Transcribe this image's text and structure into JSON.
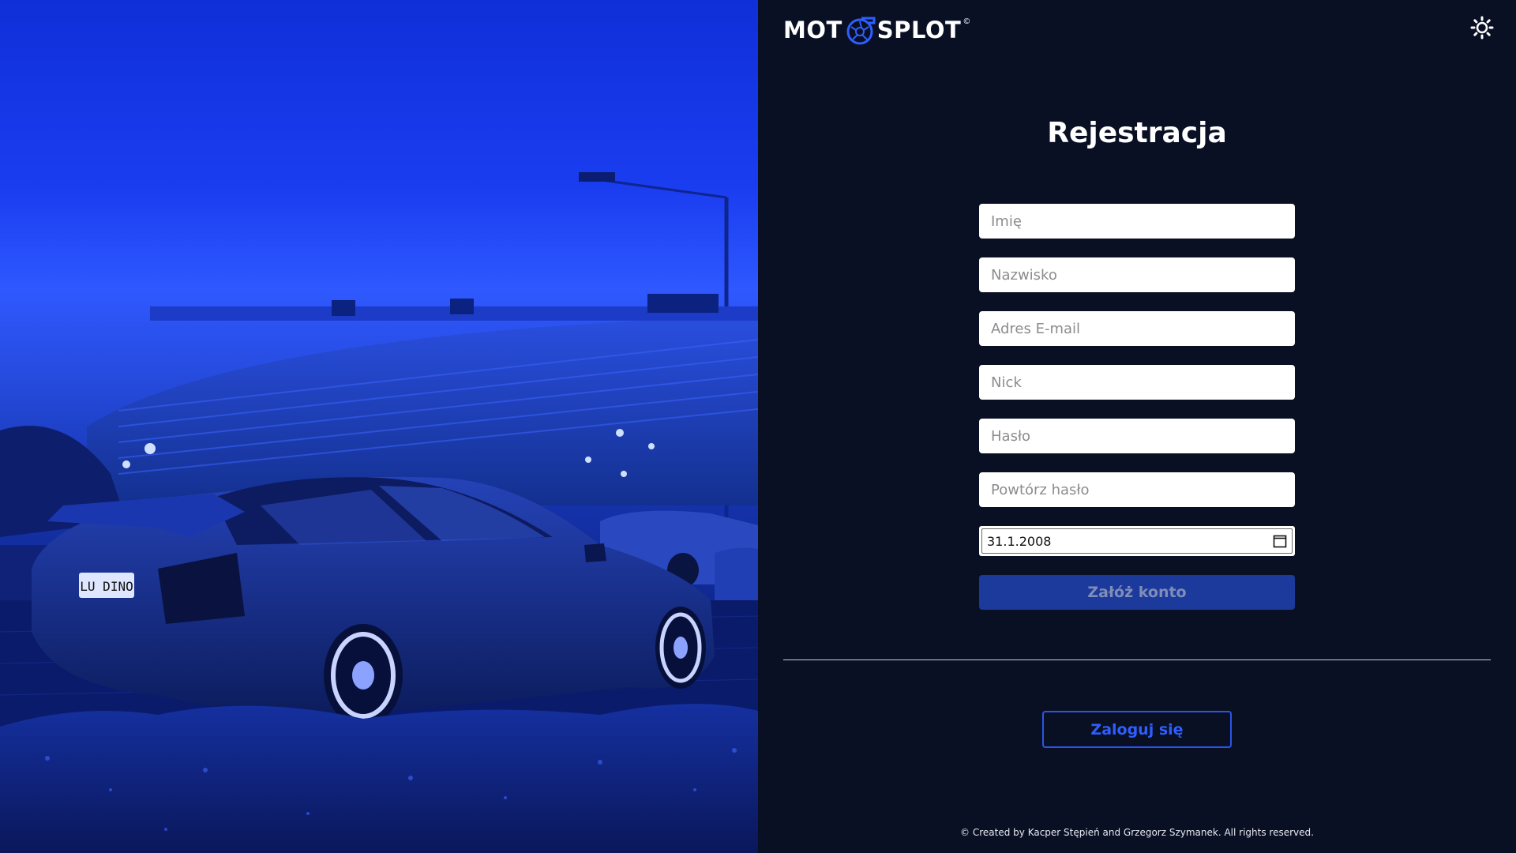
{
  "hero": {
    "plate_text": "LU DINO",
    "icons": [
      "car-photo"
    ]
  },
  "header": {
    "logo_left": "MOT",
    "logo_right": "SPLOT",
    "logo_reg": "©",
    "theme_icon": "sun-icon"
  },
  "form": {
    "title": "Rejestracja",
    "fields": {
      "first_name": {
        "placeholder": "Imię",
        "value": ""
      },
      "last_name": {
        "placeholder": "Nazwisko",
        "value": ""
      },
      "email": {
        "placeholder": "Adres E-mail",
        "value": ""
      },
      "nick": {
        "placeholder": "Nick",
        "value": ""
      },
      "password": {
        "placeholder": "Hasło",
        "value": ""
      },
      "password_repeat": {
        "placeholder": "Powtórz hasło",
        "value": ""
      },
      "birth_date": {
        "value": "31.1.2008",
        "icon": "calendar-icon"
      }
    },
    "submit_label": "Załóż konto"
  },
  "login_label": "Zaloguj się",
  "footer": "© Created by Kacper Stępień and Grzegorz Szymanek. All rights reserved.",
  "colors": {
    "panel_bg": "#0a1024",
    "submit_bg": "#1c3a9c",
    "accent": "#2f5eff",
    "hero_blue": "#1a3df0"
  }
}
